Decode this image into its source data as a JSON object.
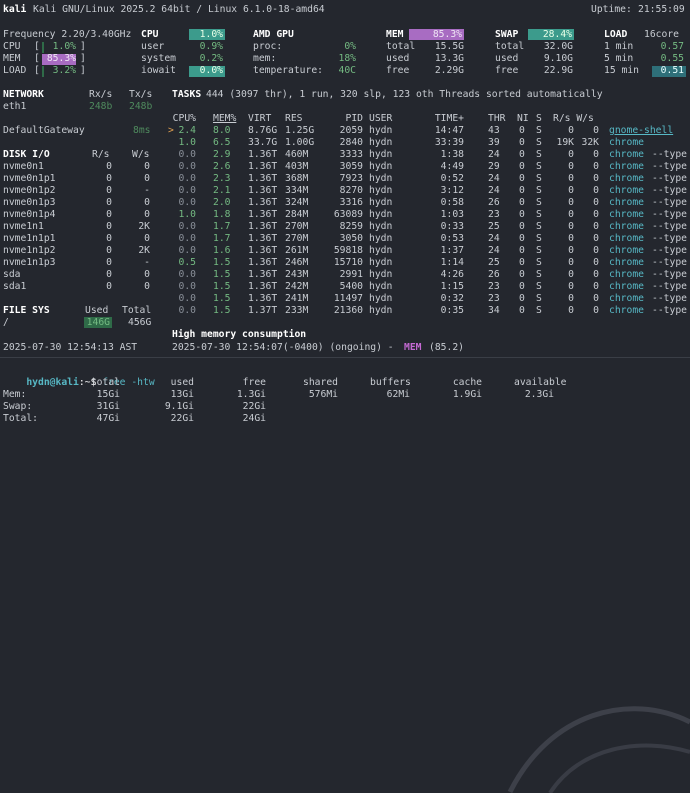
{
  "header": {
    "host": "kali",
    "system": "Kali GNU/Linux 2025.2 64bit / Linux 6.1.0-18-amd64",
    "uptime_label": "Uptime:",
    "uptime": "21:55:09"
  },
  "cpu": {
    "frequency": "Frequency 2.20/3.40GHz",
    "title": "CPU",
    "percent": "1.0%",
    "rows": [
      {
        "label": "CPU",
        "value": "1.0%",
        "fill": 0.01
      },
      {
        "label": "MEM",
        "value": "85.3%",
        "fill": 0.853
      },
      {
        "label": "LOAD",
        "value": "3.2%",
        "fill": 0.032
      }
    ],
    "stats": [
      {
        "label": "user",
        "value": "0.9%"
      },
      {
        "label": "system",
        "value": "0.2%"
      },
      {
        "label": "iowait",
        "value": "0.0%"
      }
    ]
  },
  "gpu": {
    "title": "AMD GPU",
    "stats": [
      {
        "label": "proc:",
        "value": "0%"
      },
      {
        "label": "mem:",
        "value": "18%"
      },
      {
        "label": "temperature:",
        "value": "40C"
      }
    ]
  },
  "mem": {
    "title": "MEM",
    "percent": "85.3%",
    "fill": 0.853,
    "stats": [
      {
        "label": "total",
        "value": "15.5G"
      },
      {
        "label": "used",
        "value": "13.3G"
      },
      {
        "label": "free",
        "value": "2.29G"
      }
    ]
  },
  "swap": {
    "title": "SWAP",
    "percent": "28.4%",
    "fill": 0.284,
    "stats": [
      {
        "label": "total",
        "value": "32.0G"
      },
      {
        "label": "used",
        "value": "9.10G"
      },
      {
        "label": "free",
        "value": "22.9G"
      }
    ]
  },
  "load": {
    "title": "LOAD",
    "cores": "16core",
    "stats": [
      {
        "label": "1 min",
        "value": "0.57"
      },
      {
        "label": "5 min",
        "value": "0.55"
      },
      {
        "label": "15 min",
        "value": "0.51"
      }
    ]
  },
  "network": {
    "title": "NETWORK",
    "rx_label": "Rx/s",
    "tx_label": "Tx/s",
    "iface": "eth1",
    "rx": "248b",
    "tx": "248b",
    "gateway_label": "DefaultGateway",
    "gateway_value": "8ms"
  },
  "diskio": {
    "title": "DISK I/O",
    "r_label": "R/s",
    "w_label": "W/s",
    "rows": [
      {
        "name": "nvme0n1",
        "r": "0",
        "w": "0"
      },
      {
        "name": "nvme0n1p1",
        "r": "0",
        "w": "0"
      },
      {
        "name": "nvme0n1p2",
        "r": "0",
        "w": "-"
      },
      {
        "name": "nvme0n1p3",
        "r": "0",
        "w": "0"
      },
      {
        "name": "nvme0n1p4",
        "r": "0",
        "w": "0"
      },
      {
        "name": "nvme1n1",
        "r": "0",
        "w": "2K"
      },
      {
        "name": "nvme1n1p1",
        "r": "0",
        "w": "0"
      },
      {
        "name": "nvme1n1p2",
        "r": "0",
        "w": "2K"
      },
      {
        "name": "nvme1n1p3",
        "r": "0",
        "w": "-"
      },
      {
        "name": "sda",
        "r": "0",
        "w": "0"
      },
      {
        "name": "sda1",
        "r": "0",
        "w": "0"
      }
    ]
  },
  "filesys": {
    "title": "FILE SYS",
    "used_label": "Used",
    "total_label": "Total",
    "mount": "/",
    "used": "146G",
    "total": "456G"
  },
  "tasks": {
    "label": "TASKS",
    "summary": "444 (3097 thr), 1 run, 320 slp, 123 oth Threads sorted automatically",
    "columns": {
      "cpu": "CPU%",
      "mem": "MEM%",
      "virt": "VIRT",
      "res": "RES",
      "pid": "PID",
      "user": "USER",
      "time": "TIME+",
      "thr": "THR",
      "ni": "NI",
      "s": "S",
      "rw": "R/s W/s"
    },
    "rows": [
      {
        "marker": ">",
        "cpu": "2.4",
        "mem": "8.0",
        "virt": "8.76G",
        "res": "1.25G",
        "pid": "2059",
        "user": "hydn",
        "time": "14:47",
        "thr": "43",
        "ni": "0",
        "s": "S",
        "r": "0",
        "w": "0",
        "cmd": "gnome-shell",
        "args": ""
      },
      {
        "marker": "",
        "cpu": "1.0",
        "mem": "6.5",
        "virt": "33.7G",
        "res": "1.00G",
        "pid": "2840",
        "user": "hydn",
        "time": "33:39",
        "thr": "39",
        "ni": "0",
        "s": "S",
        "r": "19K",
        "w": "32K",
        "cmd": "chrome",
        "args": ""
      },
      {
        "marker": "",
        "cpu": "0.0",
        "mem": "2.9",
        "virt": "1.36T",
        "res": "460M",
        "pid": "3333",
        "user": "hydn",
        "time": "1:38",
        "thr": "24",
        "ni": "0",
        "s": "S",
        "r": "0",
        "w": "0",
        "cmd": "chrome",
        "args": "--type"
      },
      {
        "marker": "",
        "cpu": "0.0",
        "mem": "2.6",
        "virt": "1.36T",
        "res": "403M",
        "pid": "3059",
        "user": "hydn",
        "time": "4:49",
        "thr": "29",
        "ni": "0",
        "s": "S",
        "r": "0",
        "w": "0",
        "cmd": "chrome",
        "args": "--type"
      },
      {
        "marker": "",
        "cpu": "0.0",
        "mem": "2.3",
        "virt": "1.36T",
        "res": "368M",
        "pid": "7923",
        "user": "hydn",
        "time": "0:52",
        "thr": "24",
        "ni": "0",
        "s": "S",
        "r": "0",
        "w": "0",
        "cmd": "chrome",
        "args": "--type"
      },
      {
        "marker": "",
        "cpu": "0.0",
        "mem": "2.1",
        "virt": "1.36T",
        "res": "334M",
        "pid": "8270",
        "user": "hydn",
        "time": "3:12",
        "thr": "24",
        "ni": "0",
        "s": "S",
        "r": "0",
        "w": "0",
        "cmd": "chrome",
        "args": "--type"
      },
      {
        "marker": "",
        "cpu": "0.0",
        "mem": "2.0",
        "virt": "1.36T",
        "res": "324M",
        "pid": "3316",
        "user": "hydn",
        "time": "0:58",
        "thr": "26",
        "ni": "0",
        "s": "S",
        "r": "0",
        "w": "0",
        "cmd": "chrome",
        "args": "--type"
      },
      {
        "marker": "",
        "cpu": "1.0",
        "mem": "1.8",
        "virt": "1.36T",
        "res": "284M",
        "pid": "63089",
        "user": "hydn",
        "time": "1:03",
        "thr": "23",
        "ni": "0",
        "s": "S",
        "r": "0",
        "w": "0",
        "cmd": "chrome",
        "args": "--type"
      },
      {
        "marker": "",
        "cpu": "0.0",
        "mem": "1.7",
        "virt": "1.36T",
        "res": "270M",
        "pid": "8259",
        "user": "hydn",
        "time": "0:33",
        "thr": "25",
        "ni": "0",
        "s": "S",
        "r": "0",
        "w": "0",
        "cmd": "chrome",
        "args": "--type"
      },
      {
        "marker": "",
        "cpu": "0.0",
        "mem": "1.7",
        "virt": "1.36T",
        "res": "270M",
        "pid": "3050",
        "user": "hydn",
        "time": "0:53",
        "thr": "24",
        "ni": "0",
        "s": "S",
        "r": "0",
        "w": "0",
        "cmd": "chrome",
        "args": "--type"
      },
      {
        "marker": "",
        "cpu": "0.0",
        "mem": "1.6",
        "virt": "1.36T",
        "res": "261M",
        "pid": "59818",
        "user": "hydn",
        "time": "1:37",
        "thr": "24",
        "ni": "0",
        "s": "S",
        "r": "0",
        "w": "0",
        "cmd": "chrome",
        "args": "--type"
      },
      {
        "marker": "",
        "cpu": "0.5",
        "mem": "1.5",
        "virt": "1.36T",
        "res": "246M",
        "pid": "15710",
        "user": "hydn",
        "time": "1:14",
        "thr": "25",
        "ni": "0",
        "s": "S",
        "r": "0",
        "w": "0",
        "cmd": "chrome",
        "args": "--type"
      },
      {
        "marker": "",
        "cpu": "0.0",
        "mem": "1.5",
        "virt": "1.36T",
        "res": "243M",
        "pid": "2991",
        "user": "hydn",
        "time": "4:26",
        "thr": "26",
        "ni": "0",
        "s": "S",
        "r": "0",
        "w": "0",
        "cmd": "chrome",
        "args": "--type"
      },
      {
        "marker": "",
        "cpu": "0.0",
        "mem": "1.5",
        "virt": "1.36T",
        "res": "242M",
        "pid": "5400",
        "user": "hydn",
        "time": "1:15",
        "thr": "23",
        "ni": "0",
        "s": "S",
        "r": "0",
        "w": "0",
        "cmd": "chrome",
        "args": "--type"
      },
      {
        "marker": "",
        "cpu": "0.0",
        "mem": "1.5",
        "virt": "1.36T",
        "res": "241M",
        "pid": "11497",
        "user": "hydn",
        "time": "0:32",
        "thr": "23",
        "ni": "0",
        "s": "S",
        "r": "0",
        "w": "0",
        "cmd": "chrome",
        "args": "--type"
      },
      {
        "marker": "",
        "cpu": "0.0",
        "mem": "1.5",
        "virt": "1.37T",
        "res": "233M",
        "pid": "21360",
        "user": "hydn",
        "time": "0:35",
        "thr": "34",
        "ni": "0",
        "s": "S",
        "r": "0",
        "w": "0",
        "cmd": "chrome",
        "args": "--type"
      }
    ]
  },
  "alert": {
    "title": "High memory consumption",
    "time": "2025-07-30 12:54:07(-0400) (ongoing) -",
    "metric": "MEM",
    "value": "(85.2)"
  },
  "timestamp": "2025-07-30 12:54:13 AST",
  "terminal": {
    "prompt_user": "hydn@kali",
    "prompt_path": ":~$",
    "command": "free -htw",
    "header": [
      "total",
      "used",
      "free",
      "shared",
      "buffers",
      "cache",
      "available"
    ],
    "rows": [
      {
        "label": "Mem:",
        "values": [
          "15Gi",
          "13Gi",
          "1.3Gi",
          "576Mi",
          "62Mi",
          "1.9Gi",
          "2.3Gi"
        ]
      },
      {
        "label": "Swap:",
        "values": [
          "31Gi",
          "9.1Gi",
          "22Gi",
          "",
          "",
          "",
          ""
        ]
      },
      {
        "label": "Total:",
        "values": [
          "47Gi",
          "22Gi",
          "24Gi",
          "",
          "",
          "",
          ""
        ]
      }
    ]
  },
  "colors": {
    "bg": "#24272e",
    "green": "#74ba82",
    "cyan": "#57b8c5",
    "magenta": "#a86cc2",
    "teal_bar": "#3c9b8c",
    "alert": "#c56ad4"
  }
}
